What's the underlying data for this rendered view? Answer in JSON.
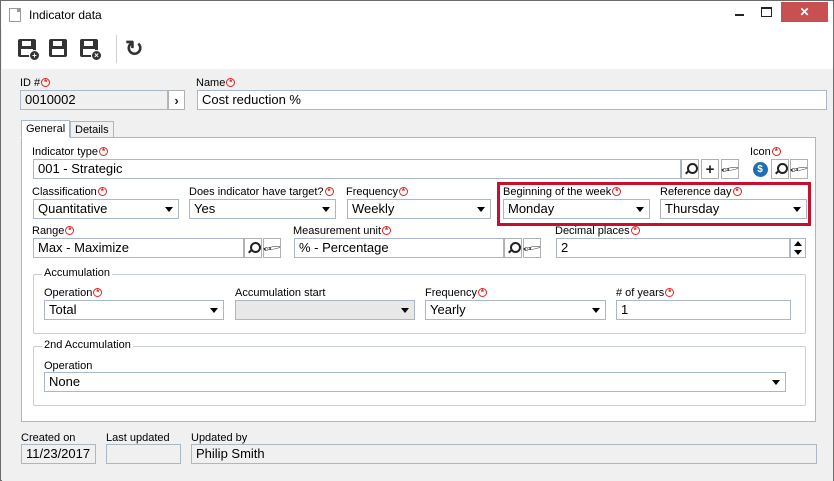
{
  "window": {
    "title": "Indicator data",
    "minimize_label": "",
    "maximize_label": "",
    "close_label": "✕"
  },
  "toolbar": {
    "buttons": [
      {
        "name": "save-and-new-button",
        "icon": "save-new-icon"
      },
      {
        "name": "save-button",
        "icon": "save-icon"
      },
      {
        "name": "save-and-close-button",
        "icon": "save-close-icon"
      },
      {
        "name": "refresh-button",
        "icon": "refresh-icon"
      }
    ],
    "refresh_glyph": "↻"
  },
  "header": {
    "id_label": "ID #",
    "id_value": "0010002",
    "name_label": "Name",
    "name_value": "Cost reduction %"
  },
  "tabs": [
    {
      "label": "General",
      "active": true
    },
    {
      "label": "Details",
      "active": false
    }
  ],
  "general": {
    "indicator_type": {
      "label": "Indicator type",
      "value": "001 - Strategic"
    },
    "icon": {
      "label": "Icon",
      "coin_glyph": "$"
    },
    "classification": {
      "label": "Classification",
      "value": "Quantitative"
    },
    "has_target": {
      "label": "Does indicator have target?",
      "value": "Yes"
    },
    "frequency": {
      "label": "Frequency",
      "value": "Weekly"
    },
    "beginning_of_week": {
      "label": "Beginning of the week",
      "value": "Monday"
    },
    "reference_day": {
      "label": "Reference day",
      "value": "Thursday"
    },
    "range": {
      "label": "Range",
      "value": "Max - Maximize"
    },
    "measurement_unit": {
      "label": "Measurement unit",
      "value": "% - Percentage"
    },
    "decimal_places": {
      "label": "Decimal places",
      "value": "2"
    },
    "accumulation": {
      "title": "Accumulation",
      "operation": {
        "label": "Operation",
        "value": "Total"
      },
      "start": {
        "label": "Accumulation start",
        "value": ""
      },
      "frequency": {
        "label": "Frequency",
        "value": "Yearly"
      },
      "years": {
        "label": "# of years",
        "value": "1"
      }
    },
    "second_accumulation": {
      "title": "2nd Accumulation",
      "operation": {
        "label": "Operation",
        "value": "None"
      }
    }
  },
  "footer": {
    "created_on": {
      "label": "Created on",
      "value": "11/23/2017"
    },
    "last_updated": {
      "label": "Last updated",
      "value": ""
    },
    "updated_by": {
      "label": "Updated by",
      "value": "Philip Smith"
    }
  },
  "colors": {
    "highlight_border": "#c8102e",
    "required_marker": "#dd2222",
    "field_border": "#a9b7c6"
  }
}
